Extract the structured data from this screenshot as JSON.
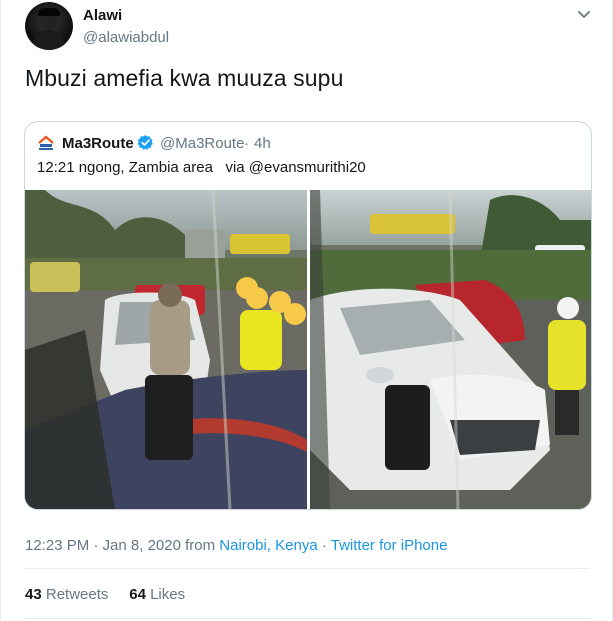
{
  "author": {
    "name": "Alawi",
    "handle": "@alawiabdul"
  },
  "tweet_text": "Mbuzi amefia kwa muuza supu",
  "quoted": {
    "name": "Ma3Route",
    "handle": "@Ma3Route",
    "separator": "·",
    "time": "4h",
    "text": "12:21 ngong, Zambia area   via @evansmurithi20",
    "logo_text": "Ma3Route"
  },
  "meta": {
    "datetime": "12:23 PM · Jan 8, 2020 from ",
    "location": "Nairobi, Kenya",
    "sep": " · ",
    "source": "Twitter for iPhone"
  },
  "stats": {
    "retweets_count": "43",
    "retweets_label": "Retweets",
    "likes_count": "64",
    "likes_label": "Likes"
  },
  "colors": {
    "link": "#1b95e0",
    "muted": "#657786",
    "text": "#14171a",
    "border": "#ccd6dd"
  },
  "icons": [
    "chevron-down-icon",
    "verified-badge-icon",
    "ma3route-logo-icon"
  ]
}
